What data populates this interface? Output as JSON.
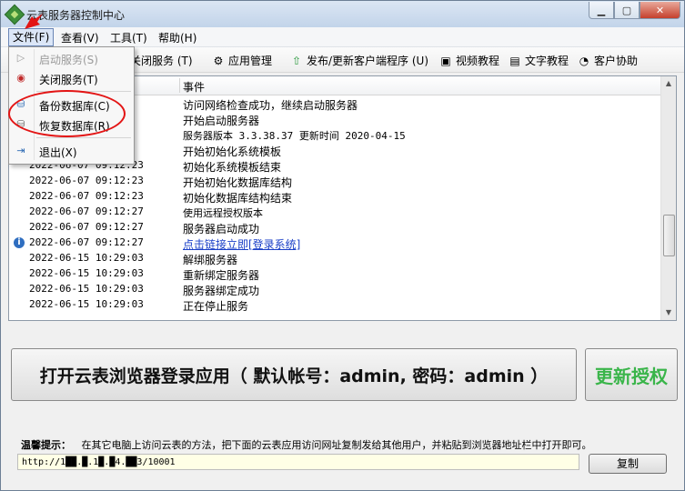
{
  "window": {
    "title": "云表服务器控制中心"
  },
  "menubar": {
    "file": "文件(F)",
    "view": "查看(V)",
    "tools": "工具(T)",
    "help": "帮助(H)"
  },
  "toolbar": {
    "close_service": "关闭服务 (T)",
    "app_manage": "应用管理",
    "publish": "发布/更新客户端程序 (U)",
    "video": "视频教程",
    "text_tutorial": "文字教程",
    "customer": "客户协助"
  },
  "file_menu": {
    "items": [
      {
        "label": "启动服务(S)",
        "icon": "play-icon",
        "disabled": true
      },
      {
        "label": "关闭服务(T)",
        "icon": "stop-icon",
        "disabled": false
      },
      {
        "label": "备份数据库(C)",
        "icon": "database-backup-icon",
        "disabled": false
      },
      {
        "label": "恢复数据库(R)",
        "icon": "database-restore-icon",
        "disabled": false
      },
      {
        "label": "退出(X)",
        "icon": "exit-icon",
        "disabled": false
      }
    ]
  },
  "log": {
    "column_event": "事件",
    "rows": [
      {
        "time": "",
        "event": "访问网络检查成功，继续启动服务器"
      },
      {
        "time": "",
        "event": "开始启动服务器"
      },
      {
        "time": "",
        "event": "服务器版本  3.3.38.37 更新时间 2020-04-15"
      },
      {
        "time": "",
        "event": "开始初始化系统模板"
      },
      {
        "time": "2022-06-07 09:12:23",
        "event": "初始化系统模板结束"
      },
      {
        "time": "2022-06-07 09:12:23",
        "event": "开始初始化数据库结构"
      },
      {
        "time": "2022-06-07 09:12:23",
        "event": "初始化数据库结构结束"
      },
      {
        "time": "2022-06-07 09:12:27",
        "event": "使用远程授权版本"
      },
      {
        "time": "2022-06-07 09:12:27",
        "event": "服务器启动成功"
      },
      {
        "time": "2022-06-07 09:12:27",
        "event": "点击链接立即[登录系统]",
        "link": true,
        "info": true
      },
      {
        "time": "2022-06-15 10:29:03",
        "event": "解绑服务器"
      },
      {
        "time": "2022-06-15 10:29:03",
        "event": "重新绑定服务器"
      },
      {
        "time": "2022-06-15 10:29:03",
        "event": "服务器绑定成功"
      },
      {
        "time": "2022-06-15 10:29:03",
        "event": "正在停止服务"
      }
    ]
  },
  "actions": {
    "open_browser": "打开云表浏览器登录应用（ 默认帐号：admin, 密码：admin ）",
    "renew": "更新授权"
  },
  "tip": {
    "label": "温馨提示：",
    "text": "在其它电脑上访问云表的方法，把下面的云表应用访问网址复制发给其他用户，并粘贴到浏览器地址栏中打开即可。",
    "url": "http://1██.█.1█.█4.██3/10001",
    "copy": "复制"
  },
  "colors": {
    "accent_green": "#3ab54a",
    "highlight_red": "#e31515",
    "link_blue": "#1a3fc7"
  }
}
